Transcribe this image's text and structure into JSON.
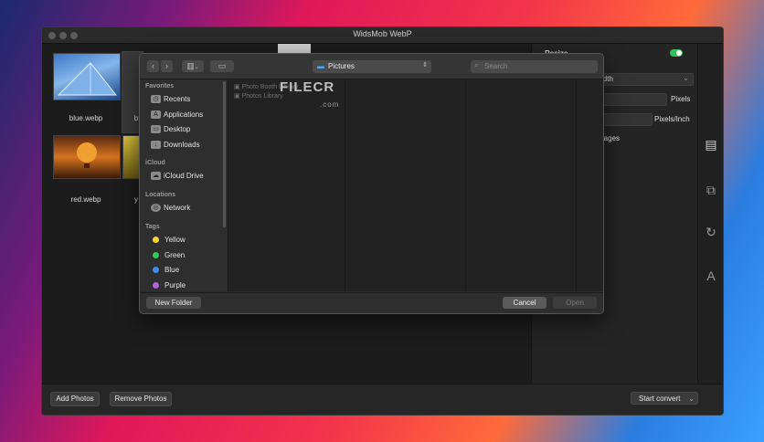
{
  "window": {
    "title": "WidsMob WebP"
  },
  "photos": [
    {
      "name": "blue.webp",
      "kind": "glass-building"
    },
    {
      "name": "red.webp",
      "kind": "hot-air-balloon"
    },
    {
      "name": "b",
      "kind": "partial"
    },
    {
      "name": "y",
      "kind": "partial"
    }
  ],
  "right_panel": {
    "resize_label": "Resize",
    "resize_enabled": true,
    "dropdown_value": "idth",
    "pixels_label": "Pixels",
    "pixels_per_inch_label": "Pixels/Inch",
    "images_label": "mages"
  },
  "bottom": {
    "add_photos": "Add Photos",
    "remove_photos": "Remove Photos",
    "start_convert": "Start convert"
  },
  "dialog": {
    "location": "Pictures",
    "search_placeholder": "Search",
    "favorites_header": "Favorites",
    "favorites": [
      {
        "label": "Recents",
        "icon": "clock-icon"
      },
      {
        "label": "Applications",
        "icon": "applications-icon"
      },
      {
        "label": "Desktop",
        "icon": "desktop-icon"
      },
      {
        "label": "Downloads",
        "icon": "download-icon"
      }
    ],
    "icloud_header": "iCloud",
    "icloud": [
      {
        "label": "iCloud Drive",
        "icon": "cloud-icon"
      }
    ],
    "locations_header": "Locations",
    "locations": [
      {
        "label": "Network",
        "icon": "network-icon"
      }
    ],
    "tags_header": "Tags",
    "tags": [
      {
        "label": "Yellow",
        "color": "#f5d33b"
      },
      {
        "label": "Green",
        "color": "#34c759"
      },
      {
        "label": "Blue",
        "color": "#3b8ef0"
      },
      {
        "label": "Purple",
        "color": "#b25ee0"
      }
    ],
    "files": [
      "Photo Booth Library",
      "Photos Library"
    ],
    "new_folder": "New Folder",
    "cancel": "Cancel",
    "open": "Open"
  },
  "watermark": {
    "main": "FILECR",
    "sub": ".com"
  },
  "colors": {
    "accent_green": "#2fc15a",
    "background_pink": "#f3354a"
  }
}
